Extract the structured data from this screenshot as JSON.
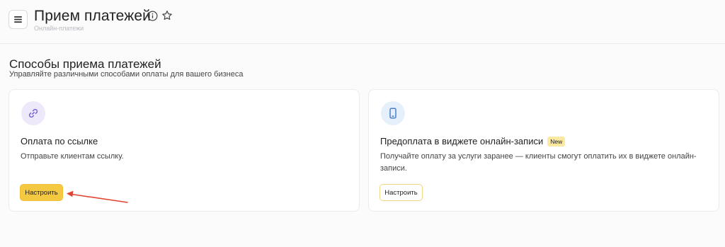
{
  "header": {
    "title": "Прием платежей",
    "subtitle": "Онлайн-платежи",
    "icons": {
      "menu": "menu-icon",
      "info": "info-icon",
      "favorite": "star-icon"
    }
  },
  "section": {
    "title": "Способы приема платежей",
    "subtitle": "Управляйте различными способами оплаты для вашего бизнеса"
  },
  "cards": [
    {
      "icon": "link-icon",
      "title": "Оплата по ссылке",
      "description": "Отправьте клиентам ссылку.",
      "button": "Настроить"
    },
    {
      "icon": "phone-icon",
      "title": "Предоплата в виджете онлайн-записи",
      "badge": "New",
      "description": "Получайте оплату за услуги заранее — клиенты смогут оплатить их в виджете онлайн-записи.",
      "button": "Настроить"
    }
  ],
  "colors": {
    "accent": "#f5c842",
    "annotation_arrow": "#e2452f",
    "link_icon_bg": "#ede9fb",
    "phone_icon_bg": "#e6f0fb"
  }
}
